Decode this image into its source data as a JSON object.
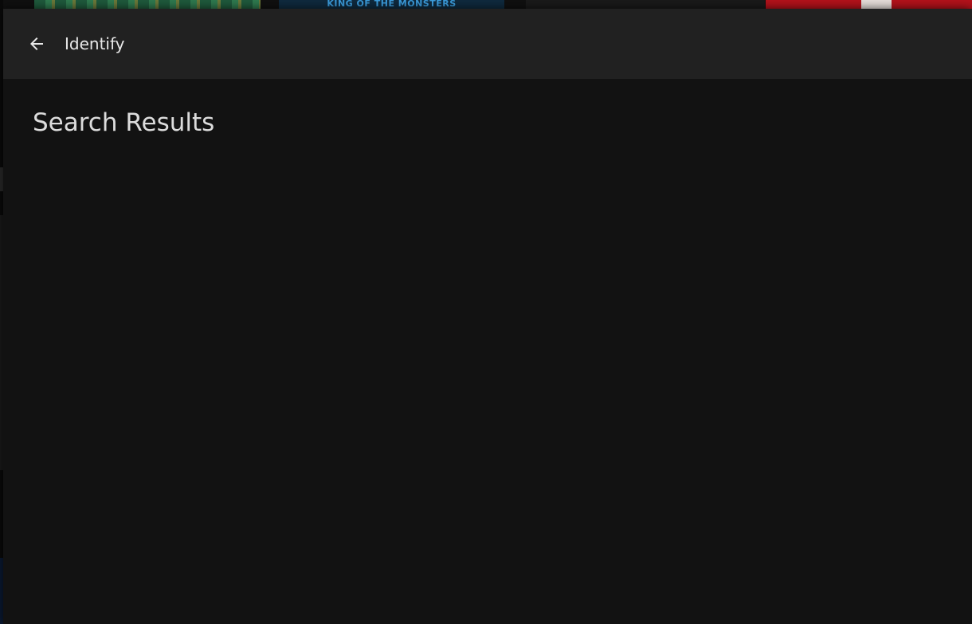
{
  "background": {
    "poster_strip": [
      {
        "name": "poster-1",
        "label": ""
      },
      {
        "name": "poster-2",
        "label": "KING OF THE MONSTERS"
      },
      {
        "name": "poster-3",
        "label": ""
      },
      {
        "name": "poster-4",
        "label": ""
      }
    ]
  },
  "dialog": {
    "header": {
      "back_icon": "arrow-left-icon",
      "title": "Identify"
    },
    "content": {
      "section_title": "Search Results",
      "results": []
    }
  },
  "colors": {
    "header_bg": "#212121",
    "content_bg": "#121212",
    "text_primary": "#e8e8e8"
  }
}
